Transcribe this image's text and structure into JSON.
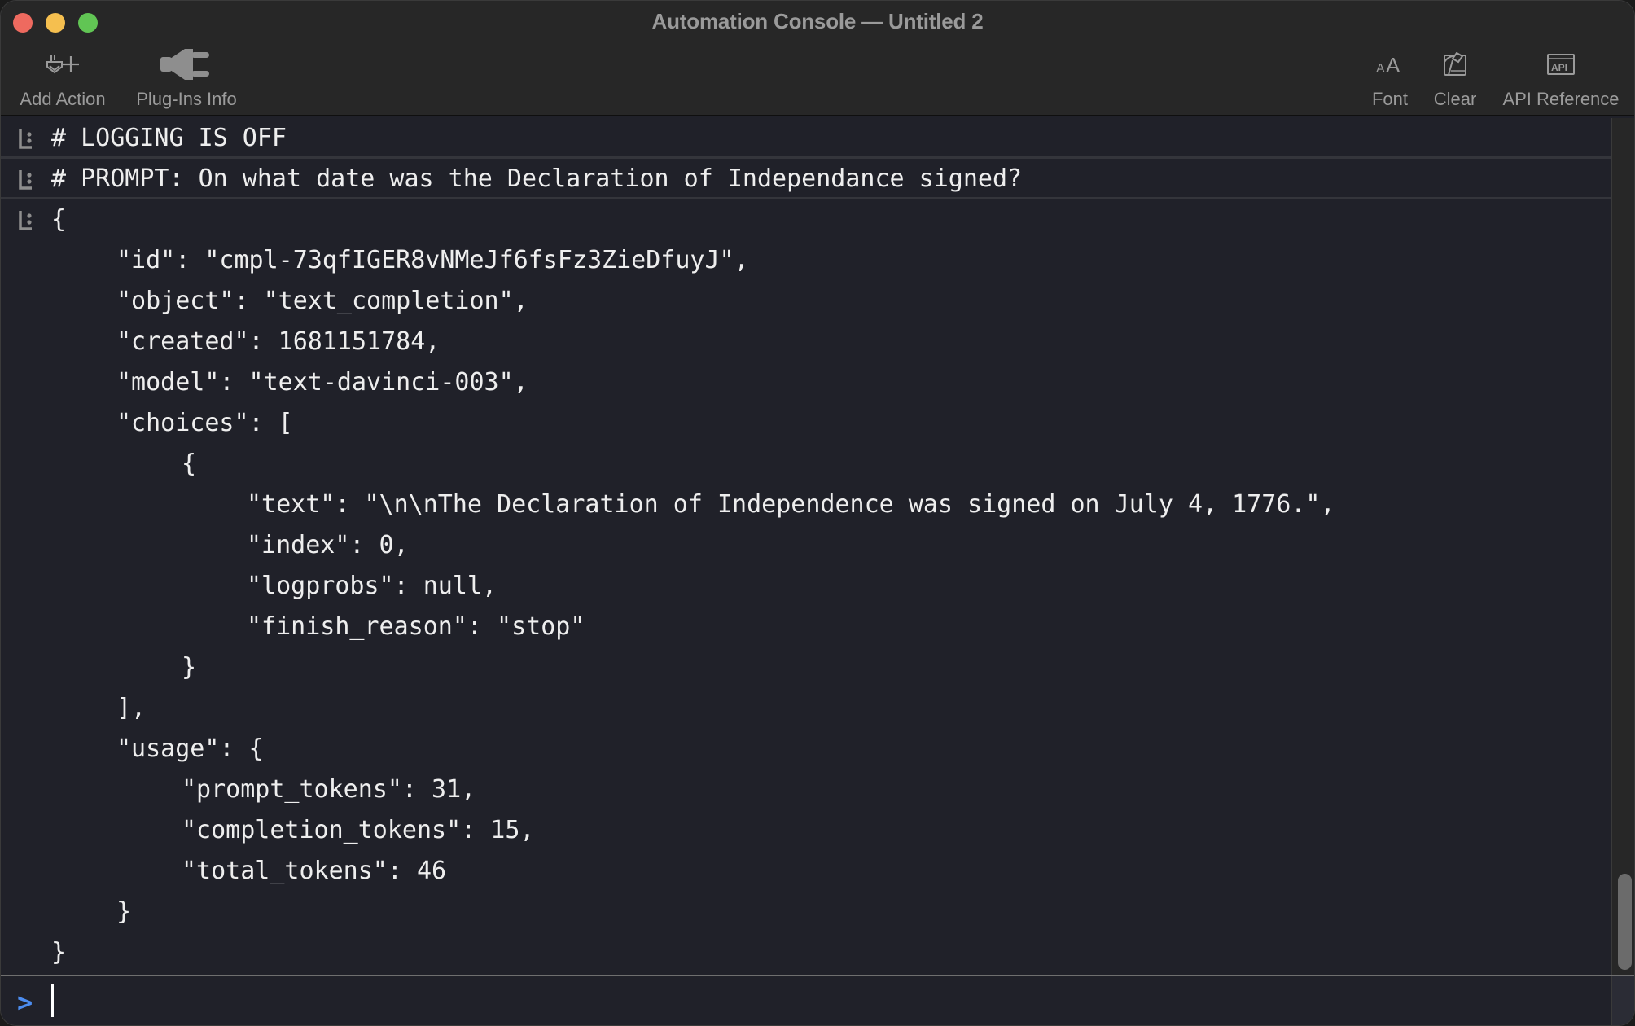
{
  "window": {
    "title": "Automation Console — Untitled 2"
  },
  "toolbar": {
    "add_action": {
      "label": "Add Action",
      "icon": "add-action-icon"
    },
    "plugins_info": {
      "label": "Plug-Ins Info",
      "icon": "plug-icon"
    },
    "font": {
      "label": "Font",
      "icon": "font-size-icon"
    },
    "clear": {
      "label": "Clear",
      "icon": "clear-icon"
    },
    "api_reference": {
      "label": "API Reference",
      "icon": "api-icon"
    }
  },
  "console": {
    "entries": [
      {
        "type": "comment",
        "text": "# LOGGING IS OFF"
      },
      {
        "type": "comment",
        "text": "# PROMPT: On what date was the Declaration of Independance signed?"
      },
      {
        "type": "result",
        "lines": [
          {
            "indent": 0,
            "text": "{"
          },
          {
            "indent": 1,
            "text": "\"id\": \"cmpl-73qfIGER8vNMeJf6fsFz3ZieDfuyJ\","
          },
          {
            "indent": 1,
            "text": "\"object\": \"text_completion\","
          },
          {
            "indent": 1,
            "text": "\"created\": 1681151784,"
          },
          {
            "indent": 1,
            "text": "\"model\": \"text-davinci-003\","
          },
          {
            "indent": 1,
            "text": "\"choices\": ["
          },
          {
            "indent": 2,
            "text": "{"
          },
          {
            "indent": 3,
            "text": "\"text\": \"\\n\\nThe Declaration of Independence was signed on July 4, 1776.\","
          },
          {
            "indent": 3,
            "text": "\"index\": 0,"
          },
          {
            "indent": 3,
            "text": "\"logprobs\": null,"
          },
          {
            "indent": 3,
            "text": "\"finish_reason\": \"stop\""
          },
          {
            "indent": 2,
            "text": "}"
          },
          {
            "indent": 1,
            "text": "],"
          },
          {
            "indent": 1,
            "text": "\"usage\": {"
          },
          {
            "indent": 2,
            "text": "\"prompt_tokens\": 31,"
          },
          {
            "indent": 2,
            "text": "\"completion_tokens\": 15,"
          },
          {
            "indent": 2,
            "text": "\"total_tokens\": 46"
          },
          {
            "indent": 1,
            "text": "}"
          },
          {
            "indent": 0,
            "text": "}"
          }
        ]
      }
    ]
  },
  "input": {
    "prompt_symbol": ">",
    "value": "",
    "placeholder": ""
  },
  "colors": {
    "accent": "#4c8df0",
    "close": "#ee6a5f",
    "minimize": "#f5bf4f",
    "maximize": "#61c554",
    "console_bg": "#202129",
    "toolbar_bg": "#272727"
  }
}
